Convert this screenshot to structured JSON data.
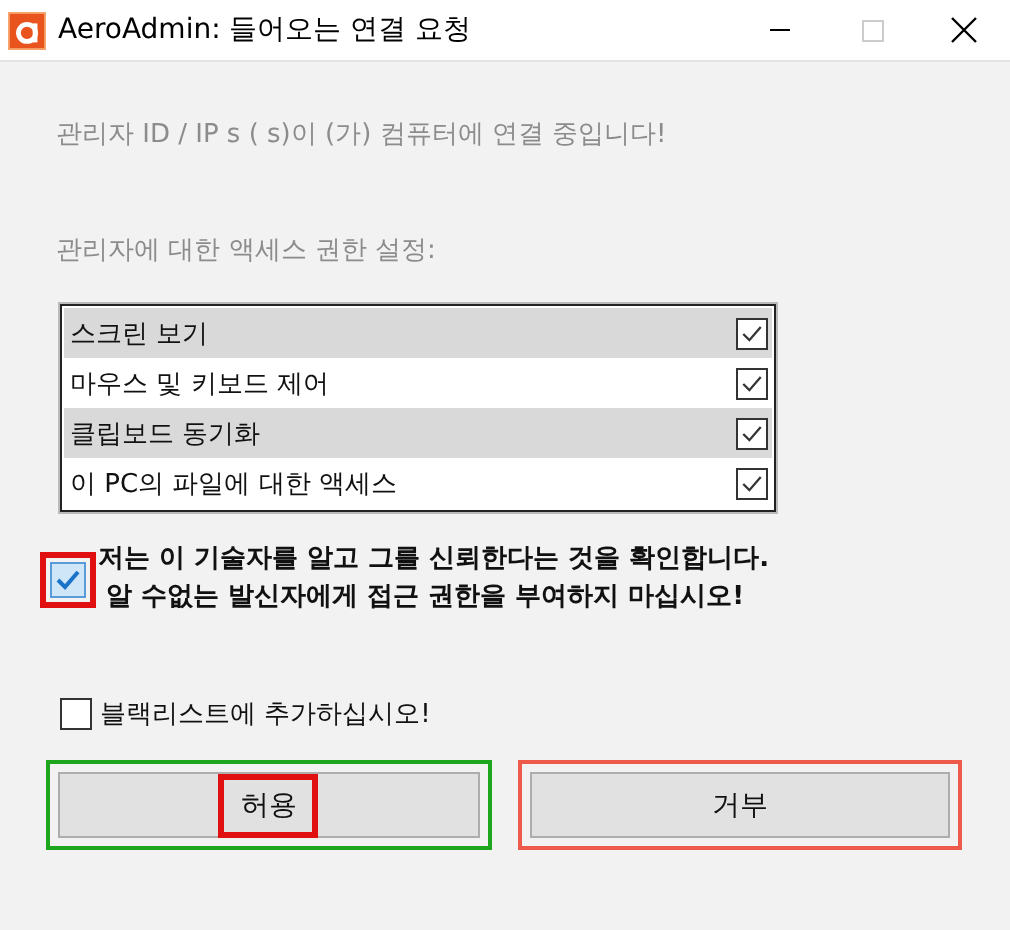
{
  "window": {
    "title": "AeroAdmin: 들어오는 연결 요청"
  },
  "message": "관리자 ID / IP  s ( s)이 (가) 컴퓨터에 연결 중입니다!",
  "permissions_label": "관리자에 대한 액세스 권한 설정:",
  "permissions": [
    {
      "label": "스크린 보기",
      "checked": true,
      "shaded": true
    },
    {
      "label": "마우스 및 키보드 제어",
      "checked": true,
      "shaded": false
    },
    {
      "label": "클립보드 동기화",
      "checked": true,
      "shaded": true
    },
    {
      "label": "이 PC의 파일에 대한 액세스",
      "checked": true,
      "shaded": false
    }
  ],
  "confirm": {
    "lines": [
      "저는 이 기술자를 알고 그를 신뢰한다는 것을 확인합니다.",
      "알 수없는 발신자에게 접근 권한을 부여하지 마십시오!"
    ],
    "checked": true,
    "highlighted": true
  },
  "blacklist": {
    "label": "블랙리스트에 추가하십시오!",
    "checked": false
  },
  "buttons": [
    {
      "label": "허용",
      "kind": "allow",
      "highlighted": true
    },
    {
      "label": "거부",
      "kind": "deny",
      "highlighted": false
    }
  ]
}
